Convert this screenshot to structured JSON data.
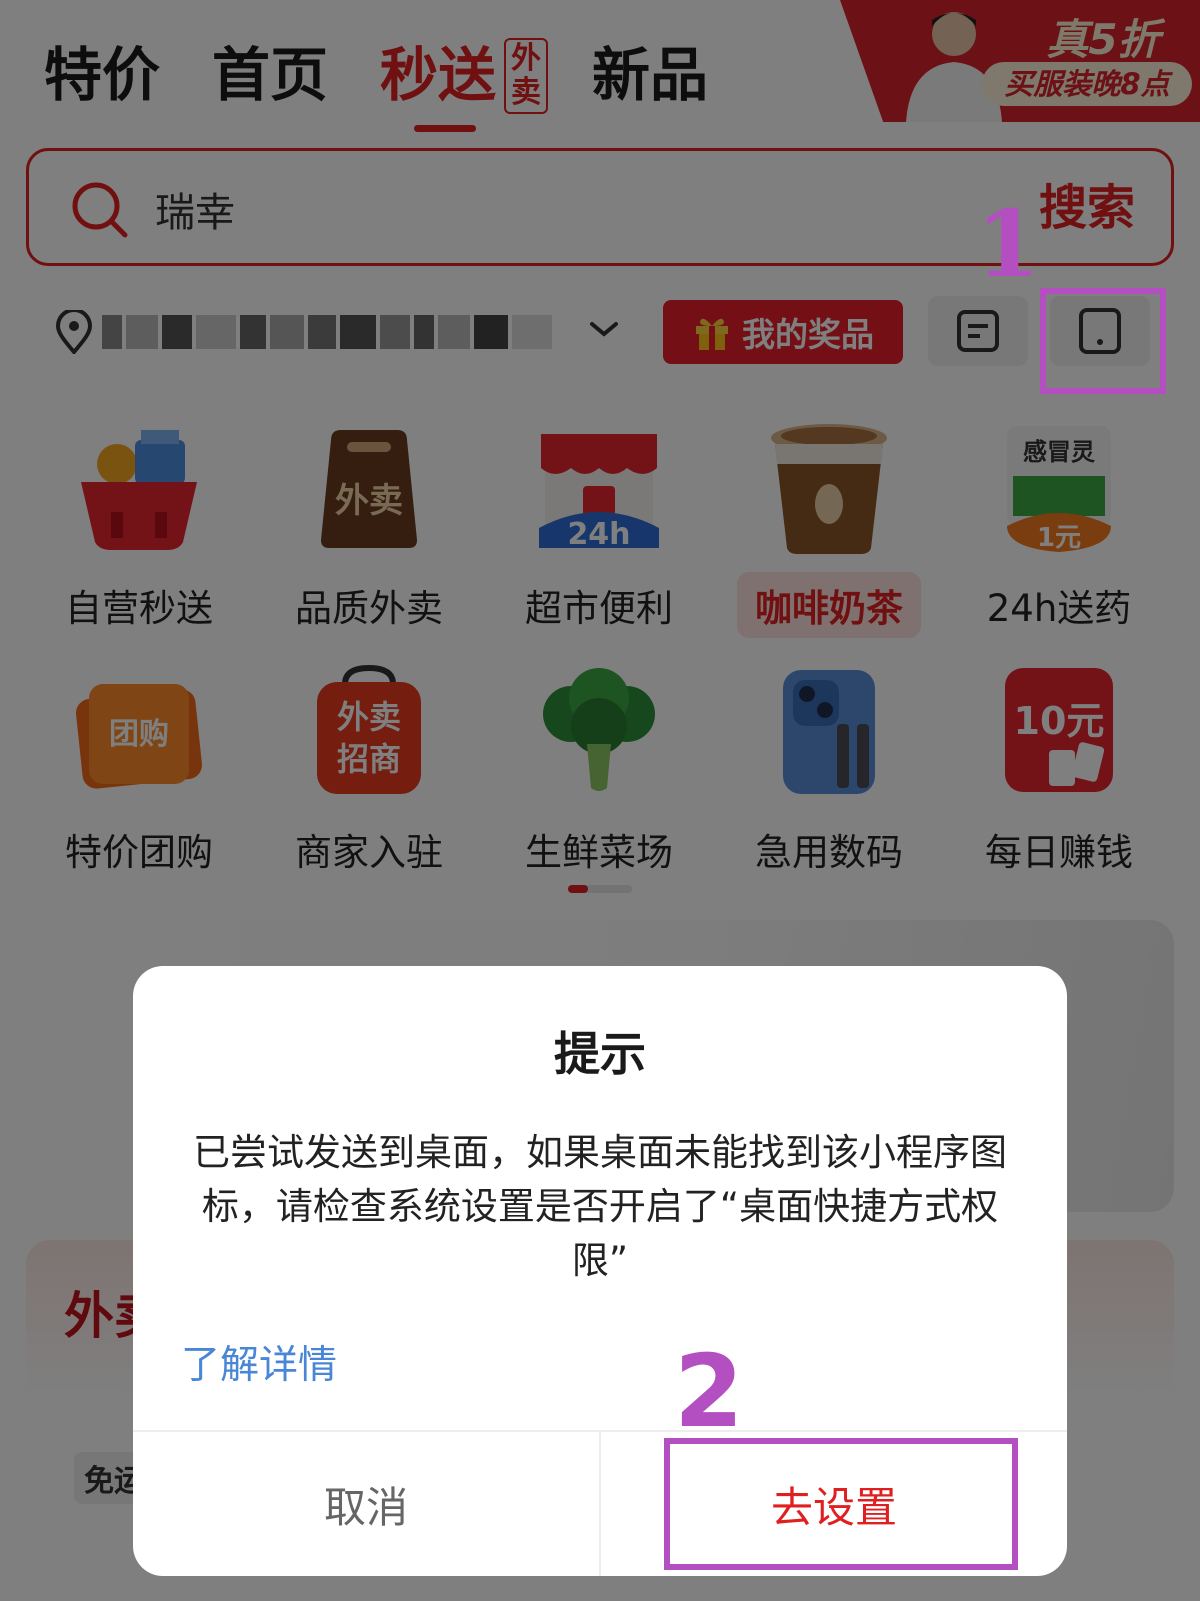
{
  "top_tabs": [
    {
      "label": "特价",
      "active": false
    },
    {
      "label": "首页",
      "active": false
    },
    {
      "label": "秒送",
      "active": true
    },
    {
      "label": "新品",
      "active": false
    }
  ],
  "active_tag": {
    "line1": "外",
    "line2": "卖"
  },
  "promo": {
    "title": "真5折",
    "subtitle": "买服装晚8点"
  },
  "search": {
    "value": "瑞幸",
    "button_label": "搜索"
  },
  "location": {
    "dropdown_icon": "chevron-down-icon"
  },
  "prize_button": {
    "label": "我的奖品"
  },
  "grid": {
    "row1": [
      {
        "label": "自营秒送",
        "icon": "basket-icon",
        "highlight": false
      },
      {
        "label": "品质外卖",
        "icon": "takeout-bag-icon",
        "highlight": false,
        "icon_text": "外卖"
      },
      {
        "label": "超市便利",
        "icon": "store-icon",
        "highlight": false,
        "icon_text": "24h"
      },
      {
        "label": "咖啡奶茶",
        "icon": "coffee-cup-icon",
        "highlight": true
      },
      {
        "label": "24h送药",
        "icon": "medicine-icon",
        "highlight": false,
        "icon_text": "感冒灵",
        "icon_text2": "1元"
      }
    ],
    "row2": [
      {
        "label": "特价团购",
        "icon": "group-buy-ticket-icon",
        "highlight": false,
        "icon_text": "团购"
      },
      {
        "label": "商家入驻",
        "icon": "merchant-bag-icon",
        "highlight": false,
        "icon_text": "外卖",
        "icon_text2": "招商"
      },
      {
        "label": "生鲜菜场",
        "icon": "broccoli-icon",
        "highlight": false
      },
      {
        "label": "急用数码",
        "icon": "phone-cable-icon",
        "highlight": false
      },
      {
        "label": "每日赚钱",
        "icon": "money-card-icon",
        "highlight": false,
        "icon_text": "10元"
      }
    ]
  },
  "section2": {
    "title": "外卖",
    "badge": "免运"
  },
  "dialog": {
    "title": "提示",
    "message": "已尝试发送到桌面，如果桌面未能找到该小程序图标，请检查系统设置是否开启了“桌面快捷方式权限”",
    "link": "了解详情",
    "cancel": "取消",
    "confirm": "去设置"
  },
  "annotations": {
    "first": "1",
    "second": "2"
  },
  "colors": {
    "brand_red": "#e02020",
    "link_blue": "#4a86d6",
    "annotation_purple": "#b44fc2"
  }
}
